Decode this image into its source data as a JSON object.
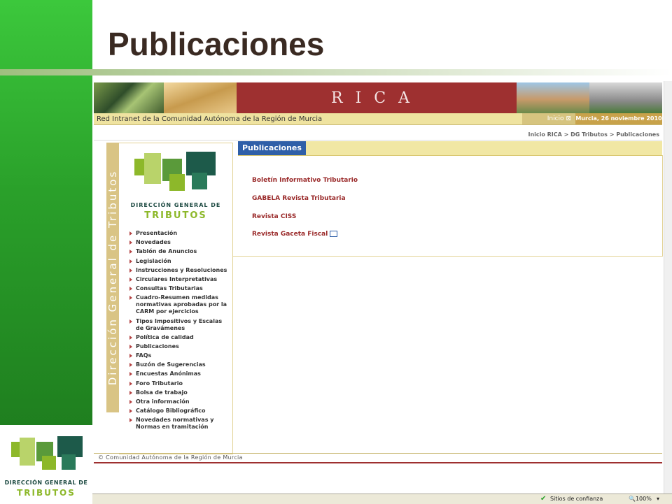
{
  "slide": {
    "title": "Publicaciones"
  },
  "banner": {
    "logo_text": "RICA",
    "network_label": "Red Intranet de la Comunidad Autónoma de la Región de Murcia",
    "inicio_label": "Inicio",
    "date_text": "Murcia, 26 noviembre 2010"
  },
  "breadcrumb": {
    "item1": "Inicio RICA",
    "sep": ">",
    "item2": "DG Tributos",
    "item3": "Publicaciones"
  },
  "vertical_banner": {
    "text": "Dirección General de Tributos"
  },
  "logo": {
    "caption_line1": "DIRECCIÓN GENERAL DE",
    "caption_line2": "TRIBUTOS"
  },
  "menu": {
    "items": [
      "Presentación",
      "Novedades",
      "Tablón de Anuncios",
      "Legislación",
      "Instrucciones y Resoluciones",
      "Circulares Interpretativas",
      "Consultas Tributarias",
      "Cuadro-Resumen medidas normativas aprobadas por la CARM por ejercicios",
      "Tipos Impositivos y Escalas de Gravámenes",
      "Política de calidad",
      "Publicaciones",
      "FAQs",
      "Buzón de Sugerencias",
      "Encuestas Anónimas",
      "Foro Tributario",
      "Bolsa de trabajo",
      "Otra información",
      "Catálogo Bibliográfico",
      "Novedades normativas y Normas en tramitación"
    ]
  },
  "content": {
    "tab_label": "Publicaciones",
    "links": [
      "Boletín Informativo Tributario",
      "GABELA Revista Tributaria",
      "Revista CISS",
      "Revista Gaceta Fiscal"
    ]
  },
  "footer": {
    "text": "© Comunidad Autónoma de la Región de Murcia"
  },
  "statusbar": {
    "zone": "Sitios de confianza",
    "zoom": "100%"
  },
  "colors": {
    "green": "#2aa02a",
    "rica_red": "#9e3030",
    "link_red": "#9a2a2a",
    "tab_blue": "#2f5fa8",
    "band_tan": "#d9c485"
  }
}
